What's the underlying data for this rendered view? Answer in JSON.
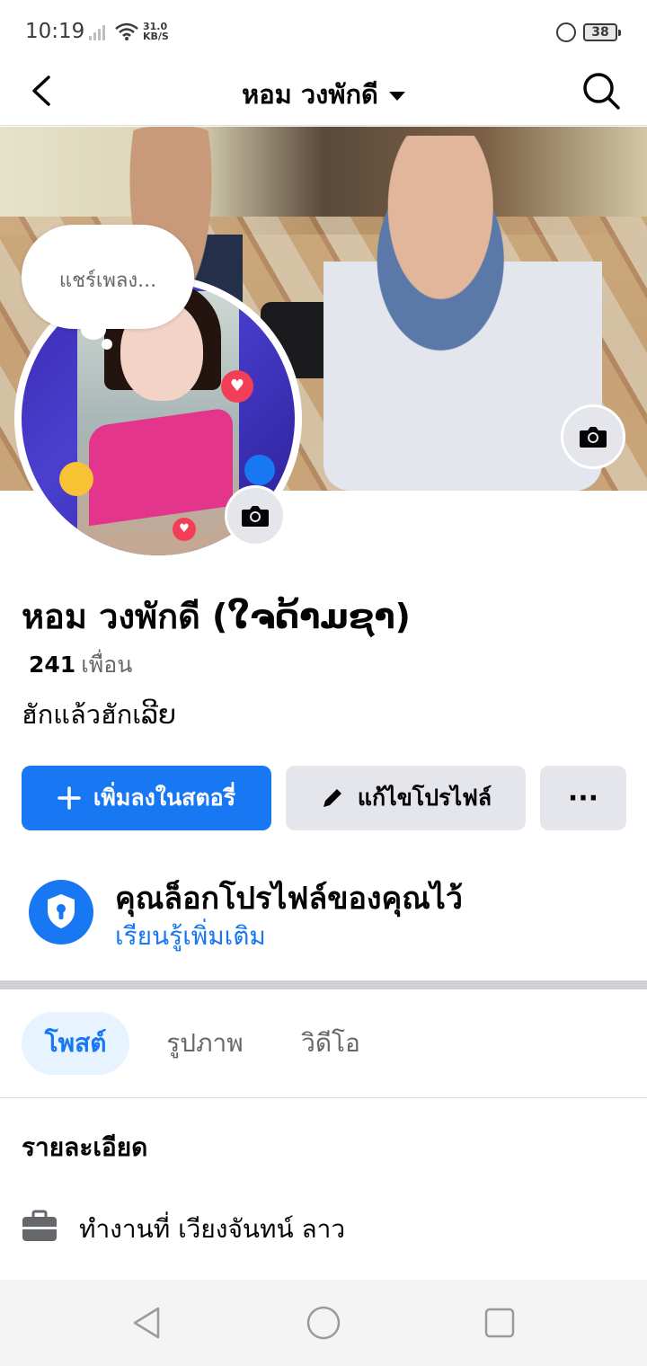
{
  "status_bar": {
    "time": "10:19",
    "net_speed_value": "31.0",
    "net_speed_unit": "KB/S",
    "battery": "38"
  },
  "header": {
    "title": "หอม วงพักดี"
  },
  "thought_bubble": {
    "text": "แชร์เพลง..."
  },
  "profile": {
    "name": "หอม วงพักดี (ໃຈດ້າມຊາ)",
    "friends_count": "241",
    "friends_label": "เพื่อน",
    "bio": "ฮักแล้วฮักเລີຍ"
  },
  "actions": {
    "add_story": "เพิ่มลงในสตอรี่",
    "edit_profile": "แก้ไขโปรไฟล์",
    "more": "···"
  },
  "lock_notice": {
    "title": "คุณล็อกโปรไฟล์ของคุณไว้",
    "link": "เรียนรู้เพิ่มเติม"
  },
  "tabs": [
    {
      "label": "โพสต์"
    },
    {
      "label": "รูปภาพ"
    },
    {
      "label": "วิดีโอ"
    }
  ],
  "details": {
    "title": "รายละเอียด",
    "work": "ทำงานที่ เวียงจันทน์ ลาว"
  },
  "colors": {
    "accent": "#1877f2",
    "secondary_button": "#e4e6eb",
    "tab_active_bg": "#e7f3ff"
  },
  "icons": [
    "back-arrow-icon",
    "search-icon",
    "camera-icon",
    "plus-icon",
    "pencil-icon",
    "shield-lock-icon",
    "briefcase-icon"
  ]
}
